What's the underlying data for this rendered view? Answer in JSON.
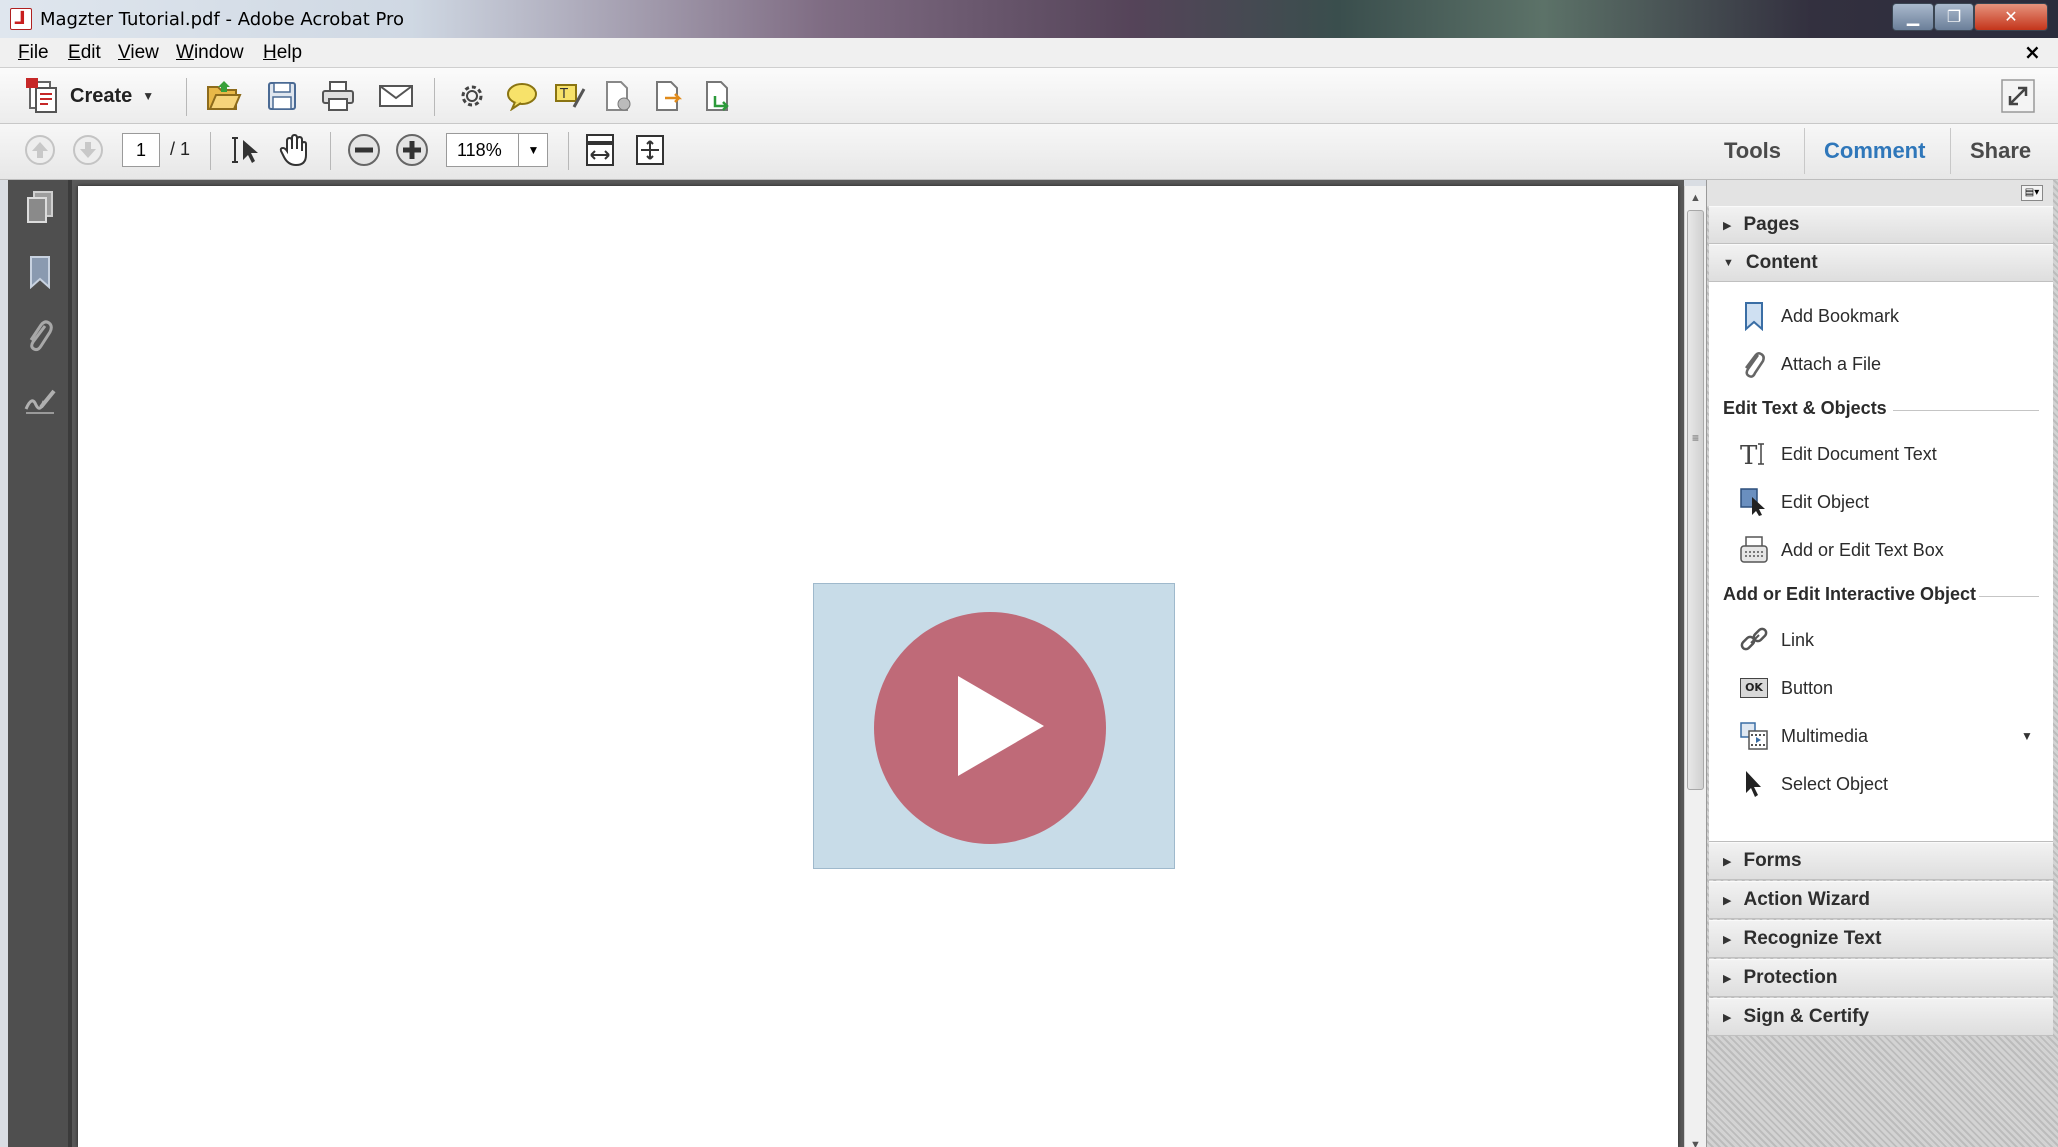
{
  "window": {
    "title": "Magzter Tutorial.pdf - Adobe Acrobat Pro",
    "min_icon": "minimize-icon",
    "max_icon": "restore-icon",
    "close_icon": "close-icon"
  },
  "menu": {
    "items": [
      "File",
      "Edit",
      "View",
      "Window",
      "Help"
    ],
    "close_label": "×"
  },
  "toolbar": {
    "create_label": "Create"
  },
  "navigation": {
    "current_page": "1",
    "total_pages": "/ 1",
    "zoom": "118%"
  },
  "tabs": [
    {
      "label": "Tools",
      "active": false
    },
    {
      "label": "Comment",
      "active": true
    },
    {
      "label": "Share",
      "active": false
    }
  ],
  "tools_pane": {
    "panels_top": [
      {
        "label": "Pages",
        "expanded": false
      },
      {
        "label": "Content",
        "expanded": true
      }
    ],
    "content_items": [
      {
        "label": "Add Bookmark",
        "icon": "bookmark-icon"
      },
      {
        "label": "Attach a File",
        "icon": "paperclip-icon"
      }
    ],
    "section_edit": "Edit Text & Objects",
    "edit_items": [
      {
        "label": "Edit Document Text",
        "icon": "text-cursor-icon"
      },
      {
        "label": "Edit Object",
        "icon": "edit-object-icon"
      },
      {
        "label": "Add or Edit Text Box",
        "icon": "typewriter-icon"
      }
    ],
    "section_interactive": "Add or Edit Interactive Object",
    "interactive_items": [
      {
        "label": "Link",
        "icon": "link-icon"
      },
      {
        "label": "Button",
        "icon": "ok-button-icon",
        "badge": "OK"
      },
      {
        "label": "Multimedia",
        "icon": "multimedia-icon"
      },
      {
        "label": "Select Object",
        "icon": "arrow-cursor-icon"
      }
    ],
    "panels_bottom": [
      {
        "label": "Forms"
      },
      {
        "label": "Action Wizard"
      },
      {
        "label": "Recognize Text"
      },
      {
        "label": "Protection"
      },
      {
        "label": "Sign & Certify"
      }
    ]
  },
  "colors": {
    "accent_tab": "#2f77ba",
    "play_circle": "#bf6a78",
    "video_bg": "#c8dce8"
  }
}
